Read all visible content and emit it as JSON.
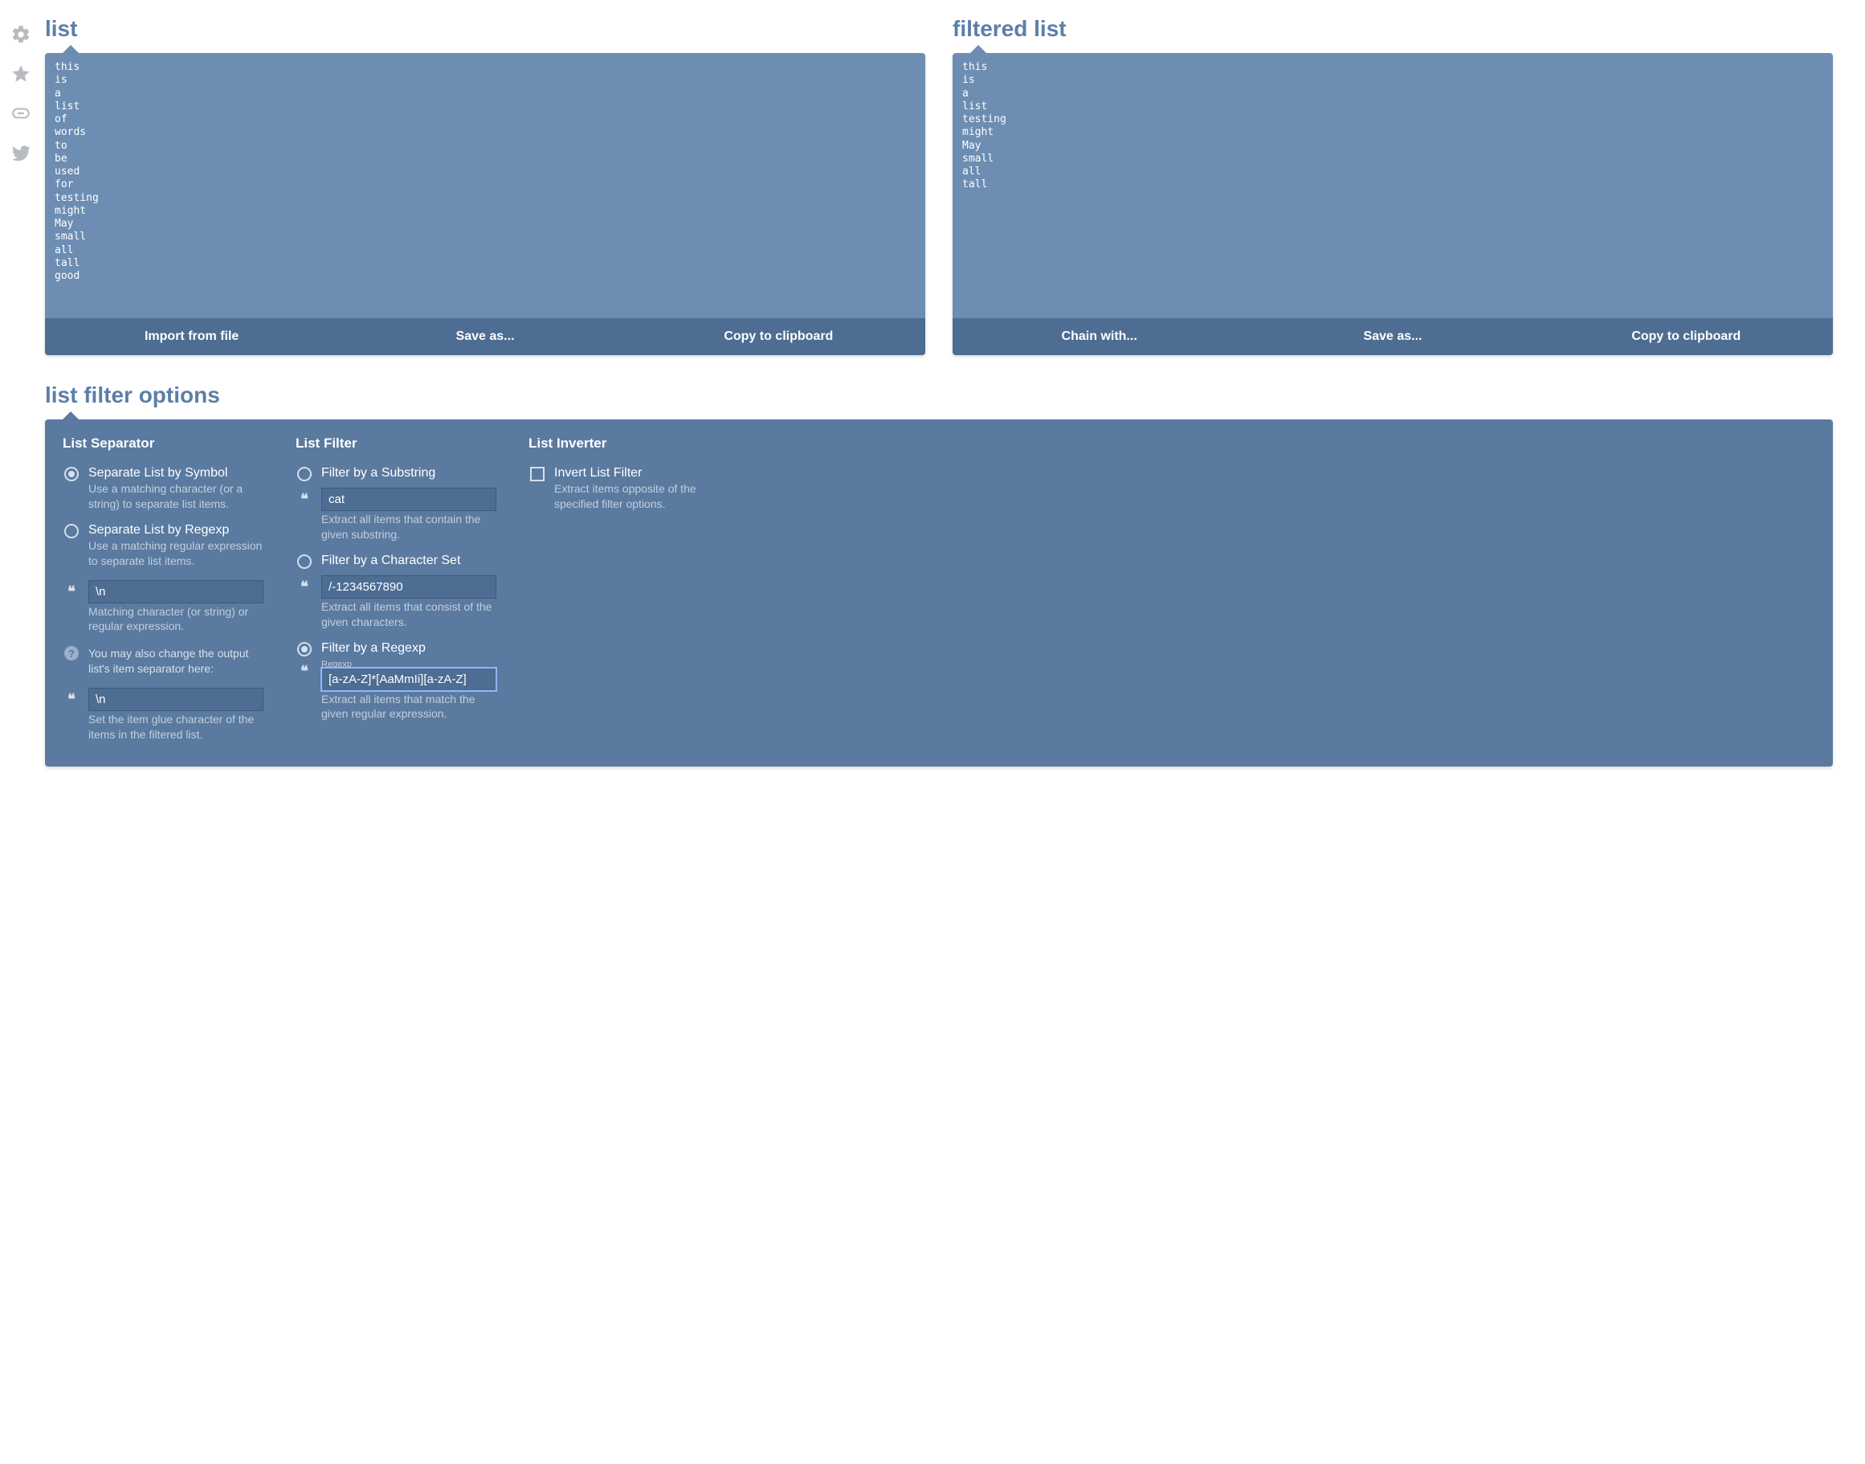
{
  "sidebar": {
    "icons": [
      "settings",
      "star",
      "link",
      "twitter"
    ]
  },
  "input_panel": {
    "title": "list",
    "content": "this\nis\na\nlist\nof\nwords\nto\nbe\nused\nfor\ntesting\nmight\nMay\nsmall\nall\ntall\ngood",
    "toolbar": {
      "import": "Import from file",
      "save": "Save as...",
      "copy": "Copy to clipboard"
    }
  },
  "output_panel": {
    "title": "filtered list",
    "content": "this\nis\na\nlist\ntesting\nmight\nMay\nsmall\nall\ntall",
    "toolbar": {
      "chain": "Chain with...",
      "save": "Save as...",
      "copy": "Copy to clipboard"
    }
  },
  "options": {
    "title": "list filter options",
    "separator": {
      "heading": "List Separator",
      "by_symbol": {
        "label": "Separate List by Symbol",
        "desc": "Use a matching character (or a string) to separate list items.",
        "selected": true
      },
      "by_regexp": {
        "label": "Separate List by Regexp",
        "desc": "Use a matching regular expression to separate list items.",
        "selected": false
      },
      "match_input": {
        "value": "\\n",
        "desc": "Matching character (or string) or regular expression."
      },
      "output_note": "You may also change the output list's item separator here:",
      "glue_input": {
        "value": "\\n",
        "desc": "Set the item glue character of the items in the filtered list."
      }
    },
    "filter": {
      "heading": "List Filter",
      "substring": {
        "label": "Filter by a Substring",
        "selected": false,
        "value": "cat",
        "desc": "Extract all items that contain the given substring."
      },
      "charset": {
        "label": "Filter by a Character Set",
        "selected": false,
        "value": "/-1234567890",
        "desc": "Extract all items that consist of the given characters."
      },
      "regexp": {
        "label": "Filter by a Regexp",
        "selected": true,
        "tiny": "Regexp",
        "value": "[a-zA-Z]*[AaMmIi][a-zA-Z]",
        "desc": "Extract all items that match the given regular expression."
      }
    },
    "inverter": {
      "heading": "List Inverter",
      "invert": {
        "label": "Invert List Filter",
        "desc": "Extract items opposite of the specified filter options.",
        "checked": false
      }
    }
  }
}
